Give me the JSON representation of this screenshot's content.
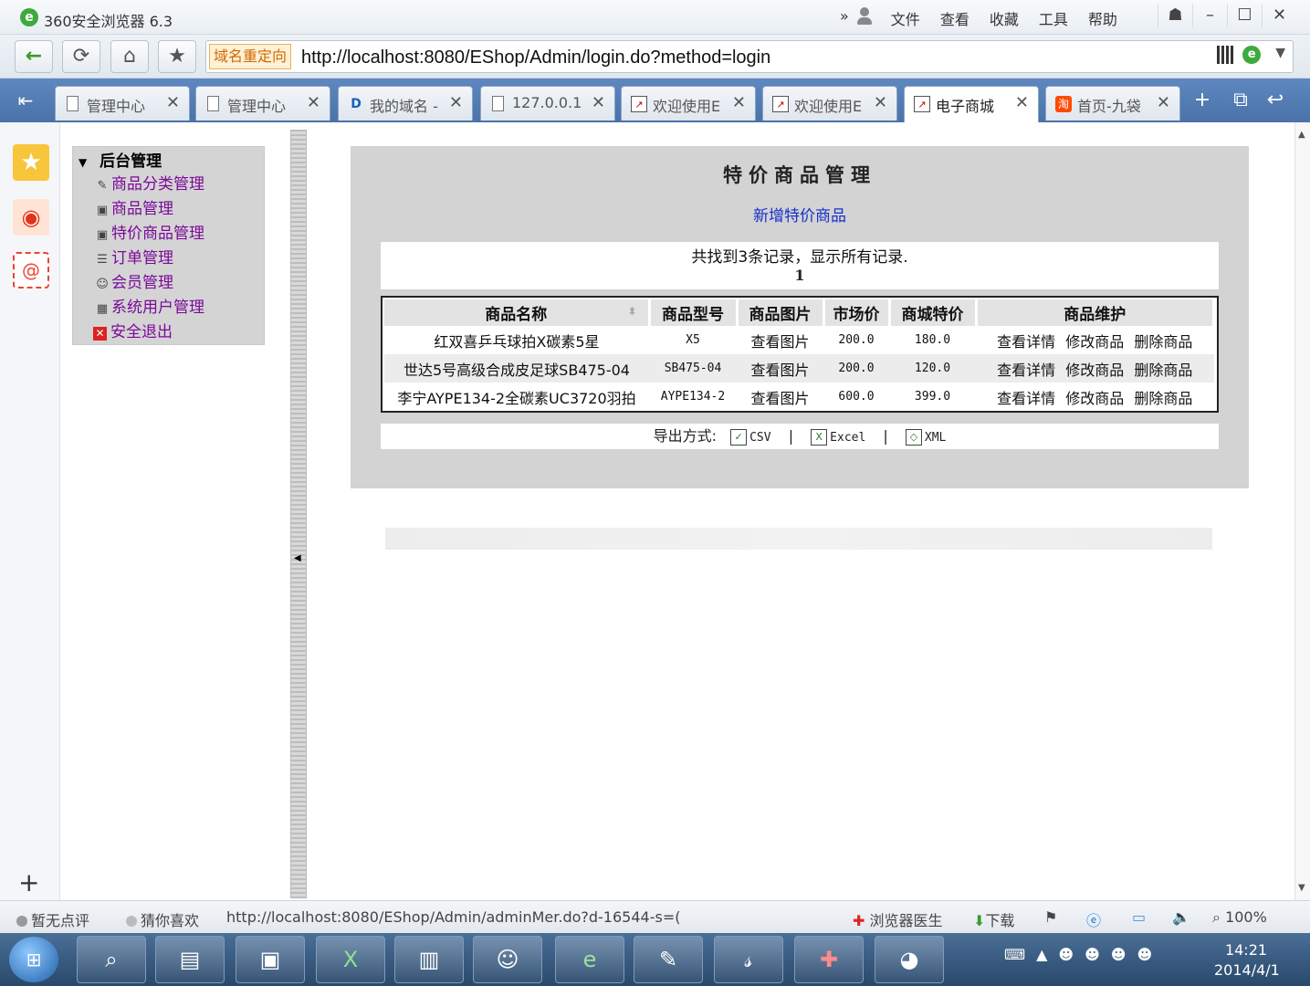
{
  "titlebar": {
    "app_title": "360安全浏览器 6.3",
    "menu": [
      "文件",
      "查看",
      "收藏",
      "工具",
      "帮助"
    ],
    "chevrons": "»"
  },
  "addressbar": {
    "redirect_badge": "域名重定向",
    "url": "http://localhost:8080/EShop/Admin/login.do?method=login"
  },
  "tabs": [
    {
      "label": "管理中心",
      "icon": "document-icon"
    },
    {
      "label": "管理中心",
      "icon": "document-icon"
    },
    {
      "label": "我的域名 -",
      "icon": "globe-icon"
    },
    {
      "label": "127.0.0.1",
      "icon": "document-icon"
    },
    {
      "label": "欢迎使用E",
      "icon": "chart-icon"
    },
    {
      "label": "欢迎使用E",
      "icon": "chart-icon"
    },
    {
      "label": "电子商城",
      "icon": "chart-icon",
      "active": true
    },
    {
      "label": "首页-九袋",
      "icon": "taobao-icon"
    }
  ],
  "tree": {
    "root": "后台管理",
    "items": [
      "商品分类管理",
      "商品管理",
      "特价商品管理",
      "订单管理",
      "会员管理",
      "系统用户管理",
      "安全退出"
    ]
  },
  "panel": {
    "title": "特价商品管理",
    "add_link": "新增特价商品",
    "records_text": "共找到3条记录，显示所有记录.",
    "page_number": "1"
  },
  "grid": {
    "headers": [
      "商品名称",
      "商品型号",
      "商品图片",
      "市场价",
      "商城特价",
      "商品维护"
    ],
    "rows": [
      {
        "name": "红双喜乒乓球拍X碳素5星",
        "model": "X5",
        "image": "查看图片",
        "market_price": "200.0",
        "special_price": "180.0"
      },
      {
        "name": "世达5号高级合成皮足球SB475-04",
        "model": "SB475-04",
        "image": "查看图片",
        "market_price": "200.0",
        "special_price": "120.0"
      },
      {
        "name": "李宁AYPE134-2全碳素UC3720羽拍",
        "model": "AYPE134-2",
        "image": "查看图片",
        "market_price": "600.0",
        "special_price": "399.0"
      }
    ],
    "actions": [
      "查看详情",
      "修改商品",
      "删除商品"
    ]
  },
  "export": {
    "label": "导出方式:",
    "csv": "CSV",
    "excel": "Excel",
    "xml": "XML",
    "sep": "|"
  },
  "statusbar": {
    "rating": "暂无点评",
    "guess": "猜你喜欢",
    "hover_url": "http://localhost:8080/EShop/Admin/adminMer.do?d-16544-s=(",
    "doctor": "浏览器医生",
    "download": "下载",
    "zoom": "100%"
  },
  "clock": {
    "time": "14:21",
    "date": "2014/4/1"
  },
  "colors": {
    "tree_link": "#7a0a99",
    "add_link": "#1530cc",
    "tabbar": "#5e88bf",
    "panel_bg": "#d3d3d3"
  }
}
